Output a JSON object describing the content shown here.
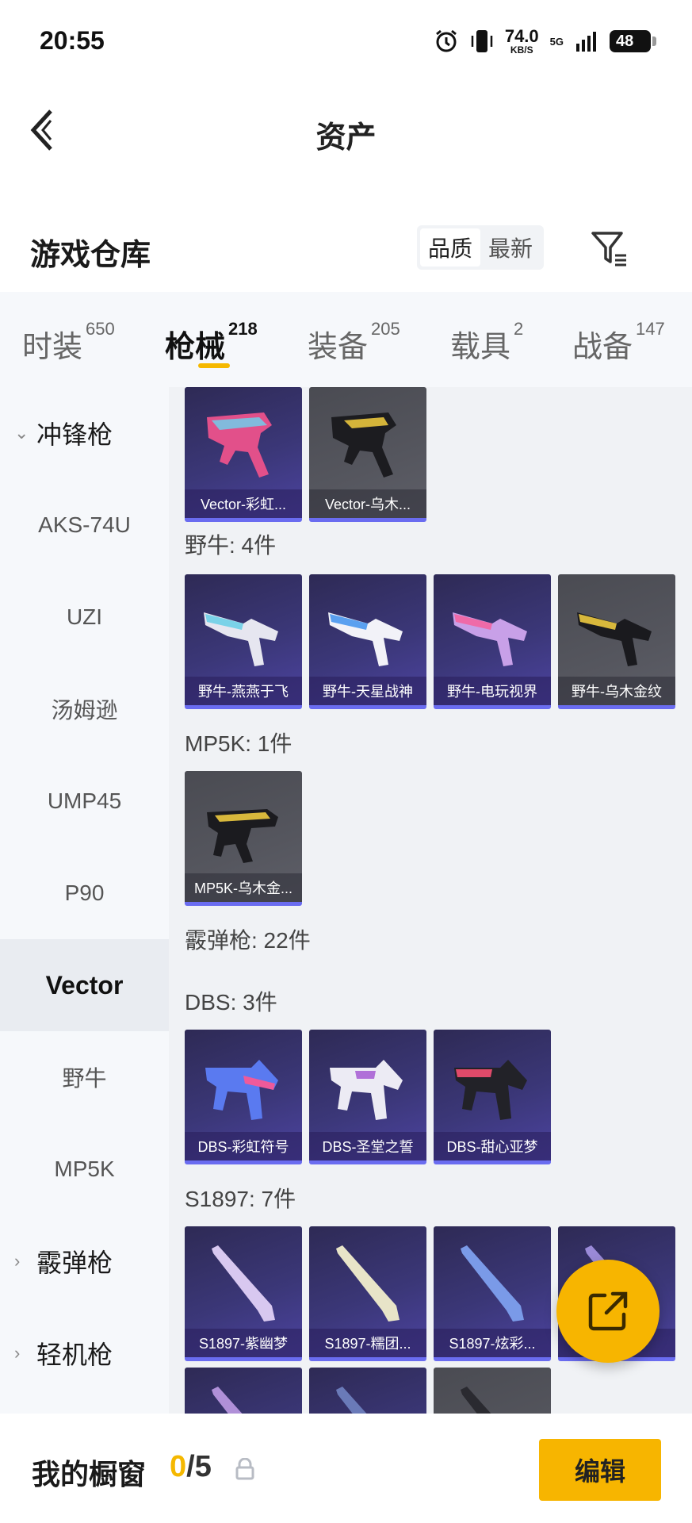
{
  "status_bar": {
    "time": "20:55",
    "net_speed": "74.0",
    "net_unit": "KB/S",
    "network": "5G",
    "battery": "48",
    "icons": [
      "alarm-icon",
      "vibrate-icon",
      "network-speed",
      "5g-icon",
      "signal-icon",
      "battery-icon"
    ]
  },
  "nav": {
    "title": "资产"
  },
  "header": {
    "title": "游戏仓库",
    "sort_options": [
      "品质",
      "最新"
    ],
    "sort_selected": "品质"
  },
  "tabs": [
    {
      "label": "时装",
      "count": "650"
    },
    {
      "label": "枪械",
      "count": "218"
    },
    {
      "label": "装备",
      "count": "205"
    },
    {
      "label": "载具",
      "count": "2"
    },
    {
      "label": "战备",
      "count": "147"
    }
  ],
  "active_tab": "枪械",
  "sidebar": {
    "items": [
      {
        "label": "冲锋枪",
        "type": "category",
        "expanded": true
      },
      {
        "label": "AKS-74U",
        "type": "item"
      },
      {
        "label": "UZI",
        "type": "item"
      },
      {
        "label": "汤姆逊",
        "type": "item"
      },
      {
        "label": "UMP45",
        "type": "item"
      },
      {
        "label": "P90",
        "type": "item"
      },
      {
        "label": "Vector",
        "type": "item",
        "selected": true
      },
      {
        "label": "野牛",
        "type": "item"
      },
      {
        "label": "MP5K",
        "type": "item"
      },
      {
        "label": "霰弹枪",
        "type": "category",
        "expanded": false
      },
      {
        "label": "轻机枪",
        "type": "category",
        "expanded": false
      }
    ]
  },
  "content": {
    "sections": [
      {
        "title": "",
        "cards": [
          {
            "label": "Vector-彩虹...",
            "style": "purple"
          },
          {
            "label": "Vector-乌木...",
            "style": "grey"
          }
        ]
      },
      {
        "title": "野牛: 4件",
        "cards": [
          {
            "label": "野牛-燕燕于飞",
            "style": "purple"
          },
          {
            "label": "野牛-天星战神",
            "style": "purple"
          },
          {
            "label": "野牛-电玩视界",
            "style": "purple"
          },
          {
            "label": "野牛-乌木金纹",
            "style": "grey"
          }
        ]
      },
      {
        "title": "MP5K: 1件",
        "cards": [
          {
            "label": "MP5K-乌木金...",
            "style": "grey"
          }
        ]
      },
      {
        "title": "霰弹枪: 22件",
        "cards": []
      },
      {
        "title": "DBS: 3件",
        "cards": [
          {
            "label": "DBS-彩虹符号",
            "style": "purple"
          },
          {
            "label": "DBS-圣堂之誓",
            "style": "purple"
          },
          {
            "label": "DBS-甜心亚梦",
            "style": "purple"
          }
        ]
      },
      {
        "title": "S1897: 7件",
        "cards": [
          {
            "label": "S1897-紫幽梦",
            "style": "purple"
          },
          {
            "label": "S1897-糯团...",
            "style": "purple"
          },
          {
            "label": "S1897-炫彩...",
            "style": "purple"
          },
          {
            "label": "S1897-...",
            "style": "purple"
          }
        ]
      }
    ]
  },
  "bottom_bar": {
    "title": "我的橱窗",
    "count_current": "0",
    "count_total": "/5",
    "edit_label": "编辑"
  },
  "colors": {
    "accent": "#f7b500",
    "card_purple": "#3b3778",
    "card_grey": "#55565e",
    "card_border": "#6a6cf0"
  }
}
